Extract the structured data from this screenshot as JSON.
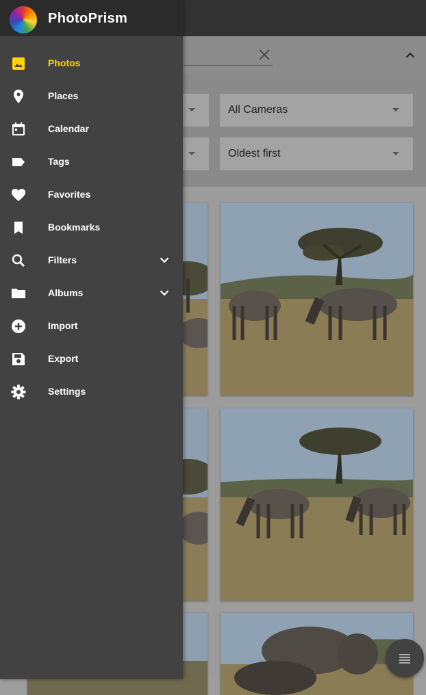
{
  "app": {
    "title": "PhotoPrism"
  },
  "nav": {
    "items": [
      {
        "label": "Photos",
        "icon": "photo-icon",
        "active": true
      },
      {
        "label": "Places",
        "icon": "place-icon"
      },
      {
        "label": "Calendar",
        "icon": "calendar-icon"
      },
      {
        "label": "Tags",
        "icon": "label-icon"
      },
      {
        "label": "Favorites",
        "icon": "heart-icon"
      },
      {
        "label": "Bookmarks",
        "icon": "bookmark-icon"
      },
      {
        "label": "Filters",
        "icon": "search-icon",
        "expandable": true
      },
      {
        "label": "Albums",
        "icon": "folder-icon",
        "expandable": true
      },
      {
        "label": "Import",
        "icon": "add-circle-icon"
      },
      {
        "label": "Export",
        "icon": "save-icon"
      },
      {
        "label": "Settings",
        "icon": "gear-icon"
      }
    ]
  },
  "filters": {
    "camera": "All Cameras",
    "sort": "Oldest first"
  },
  "colors": {
    "accent": "#ffd600",
    "drawer": "#424242",
    "drawer_header": "#2b2b2b"
  }
}
